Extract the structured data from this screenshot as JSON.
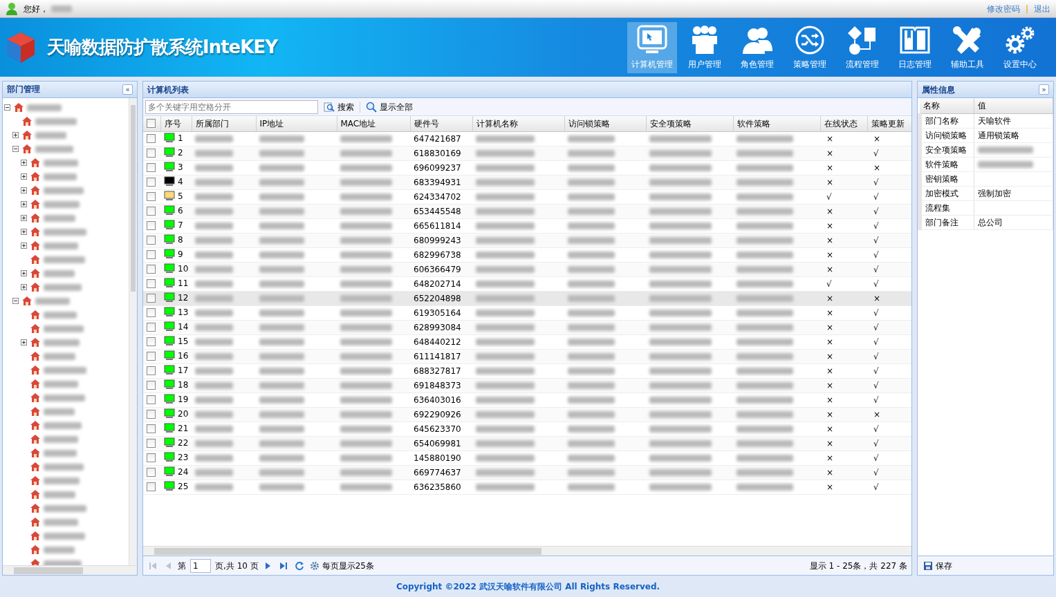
{
  "top_bar": {
    "greeting": "您好，",
    "user_redacted": true,
    "links": [
      "修改密码",
      "退出"
    ],
    "separator": "|"
  },
  "banner": {
    "title": "天喻数据防扩散系统InteKEY"
  },
  "nav": [
    {
      "label": "计算机管理",
      "selected": true
    },
    {
      "label": "用户管理",
      "selected": false
    },
    {
      "label": "角色管理",
      "selected": false
    },
    {
      "label": "策略管理",
      "selected": false
    },
    {
      "label": "流程管理",
      "selected": false
    },
    {
      "label": "日志管理",
      "selected": false
    },
    {
      "label": "辅助工具",
      "selected": false
    },
    {
      "label": "设置中心",
      "selected": false
    }
  ],
  "dept_panel": {
    "title": "部门管理",
    "collapse": "«",
    "tree": [
      {
        "kind": "expanded",
        "children": [
          {
            "kind": "leaf"
          },
          {
            "kind": "collapsed"
          },
          {
            "kind": "expanded",
            "children": [
              {
                "kind": "collapsed"
              },
              {
                "kind": "collapsed"
              },
              {
                "kind": "collapsed"
              },
              {
                "kind": "collapsed"
              },
              {
                "kind": "collapsed"
              },
              {
                "kind": "collapsed"
              },
              {
                "kind": "collapsed"
              },
              {
                "kind": "leaf"
              },
              {
                "kind": "collapsed"
              },
              {
                "kind": "collapsed"
              }
            ]
          },
          {
            "kind": "expanded",
            "children": [
              {
                "kind": "leaf"
              },
              {
                "kind": "leaf"
              },
              {
                "kind": "collapsed"
              },
              {
                "kind": "leaf"
              },
              {
                "kind": "leaf"
              },
              {
                "kind": "leaf"
              },
              {
                "kind": "leaf"
              },
              {
                "kind": "leaf"
              },
              {
                "kind": "leaf"
              },
              {
                "kind": "leaf"
              },
              {
                "kind": "leaf"
              },
              {
                "kind": "leaf"
              },
              {
                "kind": "leaf"
              },
              {
                "kind": "leaf"
              },
              {
                "kind": "leaf"
              },
              {
                "kind": "leaf"
              },
              {
                "kind": "leaf"
              },
              {
                "kind": "leaf"
              },
              {
                "kind": "leaf"
              }
            ]
          }
        ]
      }
    ]
  },
  "computer_panel": {
    "title": "计算机列表",
    "search": {
      "placeholder": "多个关键字用空格分开",
      "button": "搜索",
      "show_all": "显示全部"
    },
    "table": {
      "header_checked": false,
      "columns": [
        {
          "label": "序号",
          "kind": "number"
        },
        {
          "label": "所属部门",
          "kind": "redacted"
        },
        {
          "label": "IP地址",
          "kind": "redacted"
        },
        {
          "label": "MAC地址",
          "kind": "redacted"
        },
        {
          "label": "硬件号",
          "kind": "hardware"
        },
        {
          "label": "计算机名称",
          "kind": "redacted"
        },
        {
          "label": "访问锁策略",
          "kind": "redacted"
        },
        {
          "label": "安全项策略",
          "kind": "redacted"
        },
        {
          "label": "软件策略",
          "kind": "redacted"
        },
        {
          "label": "在线状态",
          "kind": "online"
        },
        {
          "label": "策略更新",
          "kind": "update"
        }
      ],
      "rows": [
        {
          "no": "1",
          "color": "#00ff00",
          "hardware_id": "647421687",
          "online": "×",
          "update": "×",
          "checked": false,
          "selected": false
        },
        {
          "no": "2",
          "color": "#00ff00",
          "hardware_id": "618830169",
          "online": "×",
          "update": "√",
          "checked": false,
          "selected": false
        },
        {
          "no": "3",
          "color": "#00ff00",
          "hardware_id": "696099237",
          "online": "×",
          "update": "×",
          "checked": false,
          "selected": false
        },
        {
          "no": "4",
          "color": "#000000",
          "hardware_id": "683394931",
          "online": "×",
          "update": "√",
          "checked": false,
          "selected": false
        },
        {
          "no": "5",
          "color": "#ffd97a",
          "hardware_id": "624334702",
          "online": "√",
          "update": "√",
          "checked": false,
          "selected": false
        },
        {
          "no": "6",
          "color": "#00ff00",
          "hardware_id": "653445548",
          "online": "×",
          "update": "√",
          "checked": false,
          "selected": false
        },
        {
          "no": "7",
          "color": "#00ff00",
          "hardware_id": "665611814",
          "online": "×",
          "update": "√",
          "checked": false,
          "selected": false
        },
        {
          "no": "8",
          "color": "#00ff00",
          "hardware_id": "680999243",
          "online": "×",
          "update": "√",
          "checked": false,
          "selected": false
        },
        {
          "no": "9",
          "color": "#00ff00",
          "hardware_id": "682996738",
          "online": "×",
          "update": "√",
          "checked": false,
          "selected": false
        },
        {
          "no": "10",
          "color": "#00ff00",
          "hardware_id": "606366479",
          "online": "×",
          "update": "√",
          "checked": false,
          "selected": false
        },
        {
          "no": "11",
          "color": "#00ff00",
          "hardware_id": "648202714",
          "online": "√",
          "update": "√",
          "checked": false,
          "selected": false
        },
        {
          "no": "12",
          "color": "#00ff00",
          "hardware_id": "652204898",
          "online": "×",
          "update": "×",
          "checked": false,
          "selected": true
        },
        {
          "no": "13",
          "color": "#00ff00",
          "hardware_id": "619305164",
          "online": "×",
          "update": "√",
          "checked": false,
          "selected": false
        },
        {
          "no": "14",
          "color": "#00ff00",
          "hardware_id": "628993084",
          "online": "×",
          "update": "√",
          "checked": false,
          "selected": false
        },
        {
          "no": "15",
          "color": "#00ff00",
          "hardware_id": "648440212",
          "online": "×",
          "update": "√",
          "checked": false,
          "selected": false
        },
        {
          "no": "16",
          "color": "#00ff00",
          "hardware_id": "611141817",
          "online": "×",
          "update": "√",
          "checked": false,
          "selected": false
        },
        {
          "no": "17",
          "color": "#00ff00",
          "hardware_id": "688327817",
          "online": "×",
          "update": "√",
          "checked": false,
          "selected": false
        },
        {
          "no": "18",
          "color": "#00ff00",
          "hardware_id": "691848373",
          "online": "×",
          "update": "√",
          "checked": false,
          "selected": false
        },
        {
          "no": "19",
          "color": "#00ff00",
          "hardware_id": "636403016",
          "online": "×",
          "update": "√",
          "checked": false,
          "selected": false
        },
        {
          "no": "20",
          "color": "#00ff00",
          "hardware_id": "692290926",
          "online": "×",
          "update": "×",
          "checked": false,
          "selected": false
        },
        {
          "no": "21",
          "color": "#00ff00",
          "hardware_id": "645623370",
          "online": "×",
          "update": "√",
          "checked": false,
          "selected": false
        },
        {
          "no": "22",
          "color": "#00ff00",
          "hardware_id": "654069981",
          "online": "×",
          "update": "√",
          "checked": false,
          "selected": false
        },
        {
          "no": "23",
          "color": "#00ff00",
          "hardware_id": "145880190",
          "online": "×",
          "update": "√",
          "checked": false,
          "selected": false
        },
        {
          "no": "24",
          "color": "#00ff00",
          "hardware_id": "669774637",
          "online": "×",
          "update": "√",
          "checked": false,
          "selected": false
        },
        {
          "no": "25",
          "color": "#00ff00",
          "hardware_id": "636235860",
          "online": "×",
          "update": "√",
          "checked": false,
          "selected": false
        }
      ]
    },
    "pager": {
      "first": {
        "disabled": true
      },
      "prev": {
        "disabled": true
      },
      "page_label": "第",
      "page": "1",
      "pages_label": "页,共 10 页",
      "next": {
        "disabled": false
      },
      "last": {
        "disabled": false
      },
      "page_size_label": "每页显示25条",
      "summary": "显示 1 - 25条，共 227 条"
    }
  },
  "props_panel": {
    "title": "属性信息",
    "collapse": "»",
    "columns": [
      "名称",
      "值"
    ],
    "rows": [
      {
        "name": "部门名称",
        "kind": "text",
        "value": "天喻软件"
      },
      {
        "name": "访问锁策略",
        "kind": "text",
        "value": "通用锁策略"
      },
      {
        "name": "安全项策略",
        "kind": "redacted"
      },
      {
        "name": "软件策略",
        "kind": "redacted"
      },
      {
        "name": "密钥策略",
        "kind": "empty"
      },
      {
        "name": "加密模式",
        "kind": "text",
        "value": "强制加密"
      },
      {
        "name": "流程集",
        "kind": "empty"
      },
      {
        "name": "部门备注",
        "kind": "text",
        "value": "总公司"
      }
    ],
    "save": "保存"
  },
  "footer": "Copyright ©2022 武汉天喻软件有限公司 All Rights Reserved."
}
